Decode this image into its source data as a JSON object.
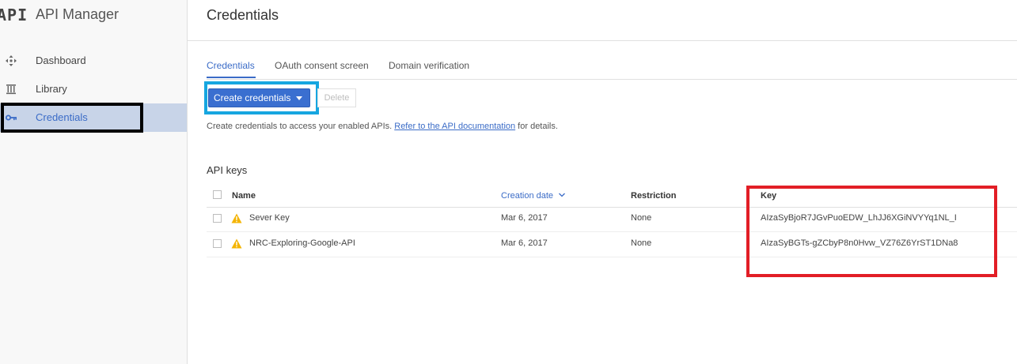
{
  "app": {
    "logo_text": "API",
    "title": "API Manager"
  },
  "sidebar": {
    "items": [
      {
        "label": "Dashboard",
        "icon": "dashboard-icon"
      },
      {
        "label": "Library",
        "icon": "library-icon"
      },
      {
        "label": "Credentials",
        "icon": "key-icon",
        "active": true
      }
    ]
  },
  "header": {
    "title": "Credentials"
  },
  "tabs": [
    {
      "label": "Credentials",
      "active": true
    },
    {
      "label": "OAuth consent screen"
    },
    {
      "label": "Domain verification"
    }
  ],
  "toolbar": {
    "create_label": "Create credentials",
    "delete_label": "Delete"
  },
  "helper": {
    "prefix": "Create credentials to access your enabled APIs. ",
    "link": "Refer to the API documentation",
    "suffix": " for details."
  },
  "api_keys": {
    "title": "API keys",
    "columns": {
      "name": "Name",
      "creation_date": "Creation date",
      "restriction": "Restriction",
      "key": "Key"
    },
    "rows": [
      {
        "name": "Sever Key",
        "creation_date": "Mar 6, 2017",
        "restriction": "None",
        "key": "AIzaSyBjoR7JGvPuoEDW_LhJJ6XGiNVYYq1NL_I"
      },
      {
        "name": "NRC-Exploring-Google-API",
        "creation_date": "Mar 6, 2017",
        "restriction": "None",
        "key": "AIzaSyBGTs-gZCbyP8n0Hvw_VZ76Z6YrST1DNa8"
      }
    ]
  },
  "colors": {
    "accent": "#3b6cc7",
    "primary_button": "#3a6fd0",
    "warning": "#f4b400",
    "annotation_black": "#000000",
    "annotation_blue": "#16a6e0",
    "annotation_red": "#e21e26"
  }
}
